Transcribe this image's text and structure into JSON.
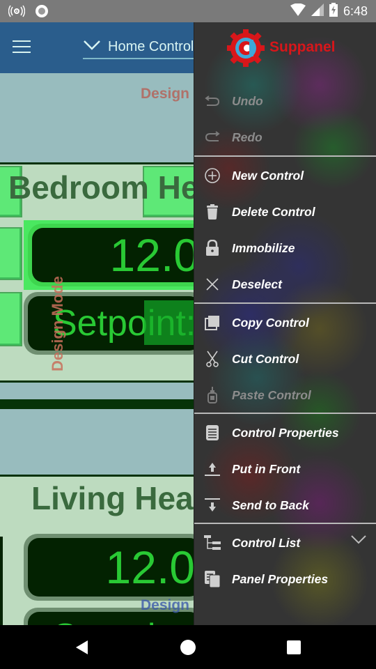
{
  "status_bar": {
    "time": "6:48",
    "icons": [
      "hotspot-icon",
      "circle-notification-icon",
      "wifi-icon",
      "cell-signal-icon",
      "battery-charging-icon"
    ]
  },
  "app_bar": {
    "menu_icon": "hamburger-icon",
    "panel_selector": {
      "icon": "chevron-down-icon",
      "title": "Home Control"
    }
  },
  "canvas": {
    "design_mode_label": "Design Mode",
    "design_label_short": "Design",
    "groups": [
      {
        "title": "Bedroom Heating",
        "temperature": "12.0",
        "setpoint_label": "Setpoint:"
      },
      {
        "title": "Living Heating",
        "temperature": "12.0",
        "setpoint_label": "Setpoint:"
      }
    ]
  },
  "drawer": {
    "brand": "Suppanel",
    "sections": [
      {
        "items": [
          {
            "label": "Undo",
            "icon": "undo-icon",
            "enabled": false
          },
          {
            "label": "Redo",
            "icon": "redo-icon",
            "enabled": false
          }
        ]
      },
      {
        "items": [
          {
            "label": "New Control",
            "icon": "add-circle-icon",
            "enabled": true
          },
          {
            "label": "Delete Control",
            "icon": "trash-icon",
            "enabled": true
          },
          {
            "label": "Immobilize",
            "icon": "lock-icon",
            "enabled": true
          },
          {
            "label": "Deselect",
            "icon": "close-icon",
            "enabled": true
          }
        ]
      },
      {
        "items": [
          {
            "label": "Copy Control",
            "icon": "copy-icon",
            "enabled": true
          },
          {
            "label": "Cut Control",
            "icon": "scissors-icon",
            "enabled": true
          },
          {
            "label": "Paste Control",
            "icon": "paste-glue-icon",
            "enabled": false
          }
        ]
      },
      {
        "items": [
          {
            "label": "Control Properties",
            "icon": "properties-icon",
            "enabled": true
          },
          {
            "label": "Put in Front",
            "icon": "bring-to-front-icon",
            "enabled": true
          },
          {
            "label": "Send to Back",
            "icon": "send-to-back-icon",
            "enabled": true
          }
        ]
      },
      {
        "items": [
          {
            "label": "Control List",
            "icon": "tree-list-icon",
            "enabled": true,
            "expandable": true
          },
          {
            "label": "Panel Properties",
            "icon": "panel-properties-icon",
            "enabled": true
          }
        ]
      }
    ]
  },
  "nav_bar": {
    "back": "back-icon",
    "home": "home-icon",
    "recents": "recents-icon"
  }
}
